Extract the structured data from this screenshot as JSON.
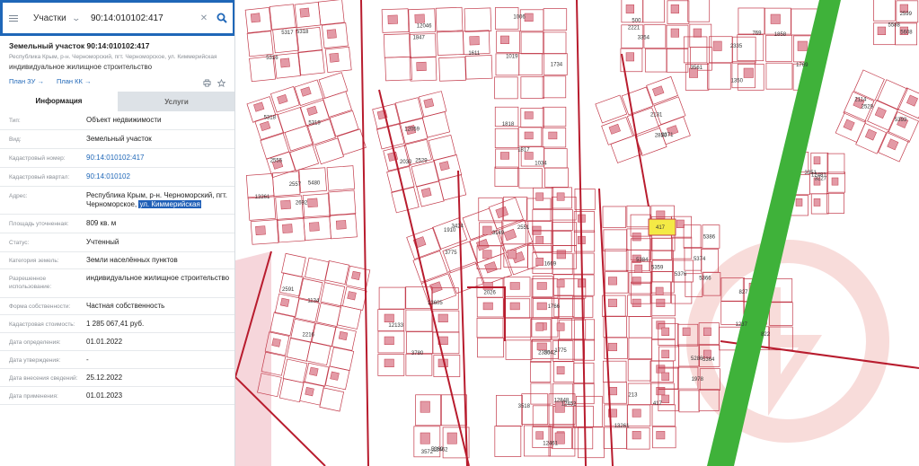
{
  "search": {
    "type_label": "Участки",
    "query": "90:14:010102:417"
  },
  "object": {
    "title": "Земельный участок 90:14:010102:417",
    "address": "Республика Крым, р-н. Черноморский, пгт. Черноморское, ул. Киммерийская",
    "use": "индивидуальное жилищное строительство",
    "plan_zu": "План ЗУ →",
    "plan_kk": "План КК →"
  },
  "tabs": {
    "info": "Информация",
    "services": "Услуги"
  },
  "props": {
    "type": {
      "k": "Тип:",
      "v": "Объект недвижимости"
    },
    "kind": {
      "k": "Вид:",
      "v": "Земельный участок"
    },
    "cad_number": {
      "k": "Кадастровый номер:",
      "v": "90:14:010102:417"
    },
    "cad_quarter": {
      "k": "Кадастровый квартал:",
      "v": "90:14:010102"
    },
    "address": {
      "k": "Адрес:",
      "v_main": "Республика Крым, р-н. Черноморский, пгт. Черноморское, ",
      "v_hl": "ул. Киммерийская"
    },
    "area": {
      "k": "Площадь уточненная:",
      "v": "809 кв. м"
    },
    "status": {
      "k": "Статус:",
      "v": "Учтенный"
    },
    "category": {
      "k": "Категория земель:",
      "v": "Земли населённых пунктов"
    },
    "permitted_use": {
      "k": "Разрешенное использование:",
      "v": "индивидуальное жилищное строительство"
    },
    "ownership": {
      "k": "Форма собственности:",
      "v": "Частная собственность"
    },
    "cad_value": {
      "k": "Кадастровая стоимость:",
      "v": "1 285 067,41 руб."
    },
    "date_determined": {
      "k": "Дата определения:",
      "v": "01.01.2022"
    },
    "date_approved": {
      "k": "Дата утверждения:",
      "v": "-"
    },
    "date_entered": {
      "k": "Дата внесения сведений:",
      "v": "25.12.2022"
    },
    "date_applied": {
      "k": "Дата применения:",
      "v": "01.01.2023"
    }
  },
  "map": {
    "labels": [
      "5318",
      "5316",
      "5317",
      "5318",
      "5319",
      "2555",
      "5480",
      "2557",
      "2692",
      "2591",
      "1134",
      "2216",
      "1847",
      "12046",
      "1611",
      "12059",
      "2529",
      "2030",
      "1910",
      "3424",
      "3775",
      "13605",
      "3780",
      "12133",
      "1019",
      "1006",
      "1734",
      "1034",
      "1818",
      "1817",
      "1669",
      "3149",
      "2551",
      "2542",
      "2026",
      "2350",
      "12848",
      "1775",
      "1766",
      "13261",
      "417",
      "213",
      "500",
      "3354",
      "2221",
      "2850",
      "2131",
      "2371",
      "3561",
      "1350",
      "2335",
      "769",
      "1858",
      "1769",
      "2599",
      "5608",
      "5588",
      "2529",
      "2114",
      "5393",
      "5376",
      "5384",
      "5359",
      "5374",
      "5366",
      "5386",
      "1237",
      "827",
      "822",
      "3227",
      "3351",
      "12481",
      "12452",
      "12461",
      "3518",
      "1978",
      "5286",
      "5364",
      "3572",
      "5369",
      "12462",
      "13261"
    ],
    "colors": {
      "parcel_line": "#c23a4a",
      "road_line": "#b81c2e",
      "green_strip": "#3fb23a",
      "selected": "#f4ea45"
    }
  }
}
